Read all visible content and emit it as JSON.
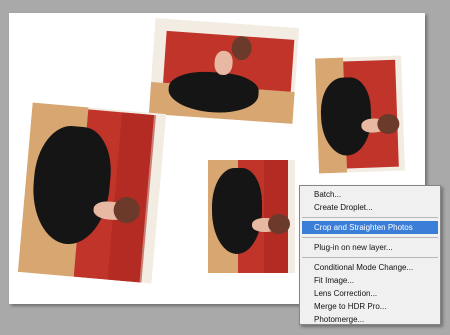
{
  "photos": [
    {
      "subject": "woman-in-black-gown-photo"
    },
    {
      "subject": "woman-in-black-gown-photo"
    },
    {
      "subject": "woman-in-black-gown-photo"
    },
    {
      "subject": "woman-in-black-gown-photo"
    }
  ],
  "colors": {
    "workspace": "#a9a9a9",
    "canvas": "#ffffff",
    "menu_background": "#f0f0f0",
    "menu_highlight": "#3b7ed8",
    "wall_red": "#c1342a",
    "floor": "#d8a671",
    "dress": "#151515"
  },
  "menu": {
    "group1": [
      "Batch...",
      "Create Droplet..."
    ],
    "selected": "Crop and Straighten Photos",
    "group2": [
      "Plug-in on new layer..."
    ],
    "group3": [
      "Conditional Mode Change...",
      "Fit Image...",
      "Lens Correction...",
      "Merge to HDR Pro...",
      "Photomerge..."
    ]
  }
}
